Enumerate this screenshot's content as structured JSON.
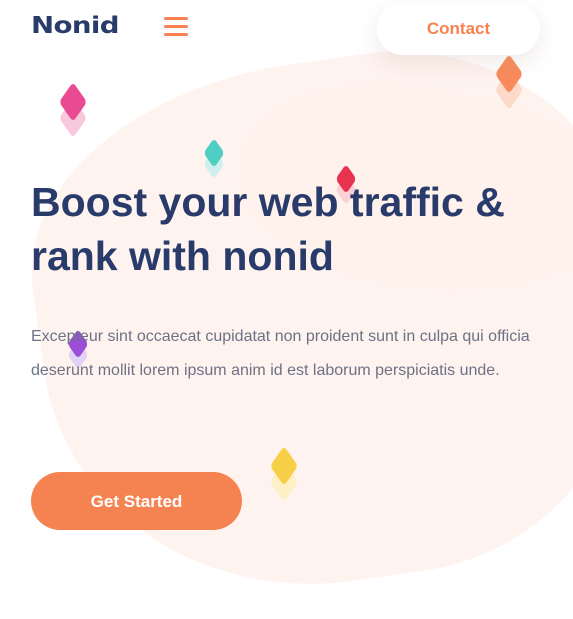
{
  "header": {
    "logo": "Nonid",
    "menu_icon": "hamburger-menu-icon",
    "contact_label": "Contact"
  },
  "hero": {
    "title_line1": "Boost your web traffic &",
    "title_line2": "rank with nonid",
    "description": "Excepteur sint occaecat cupidatat non proident sunt in culpa qui officia deserunt mollit lorem ipsum anim id est laborum perspiciatis unde.",
    "cta_label": "Get Started"
  },
  "colors": {
    "accent": "#f58352",
    "heading": "#283b6a",
    "body_text": "#6c7286",
    "background_blob": "#fff3ef"
  }
}
